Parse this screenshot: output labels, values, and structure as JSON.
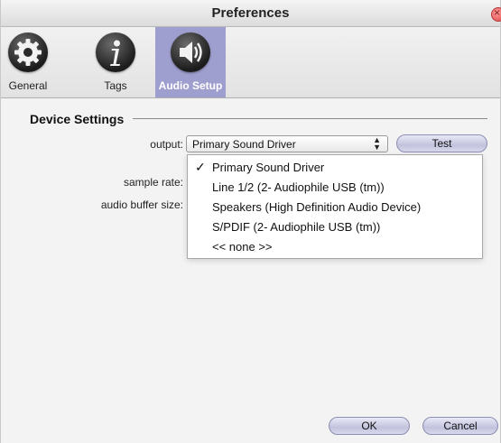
{
  "window": {
    "title": "Preferences"
  },
  "toolbar": {
    "tabs": [
      {
        "label": "General",
        "icon": "gear-icon"
      },
      {
        "label": "Tags",
        "icon": "info-icon"
      },
      {
        "label": "Audio Setup",
        "icon": "speaker-icon",
        "selected": true
      }
    ]
  },
  "device_settings": {
    "title": "Device Settings",
    "output_label": "output:",
    "output_value": "Primary Sound Driver",
    "test_label": "Test",
    "sample_rate_label": "sample rate:",
    "buffer_size_label": "audio buffer size:"
  },
  "output_menu": {
    "items": [
      {
        "label": "Primary Sound Driver",
        "checked": "✓"
      },
      {
        "label": "Line 1/2 (2- Audiophile USB (tm))"
      },
      {
        "label": "Speakers (High Definition Audio Device)"
      },
      {
        "label": "S/PDIF (2- Audiophile USB (tm))"
      },
      {
        "label": "<< none >>"
      }
    ]
  },
  "footer": {
    "ok_label": "OK",
    "cancel_label": "Cancel"
  },
  "colors": {
    "selected_tab": "#9f9fcf",
    "button": "#c2c2dd"
  }
}
